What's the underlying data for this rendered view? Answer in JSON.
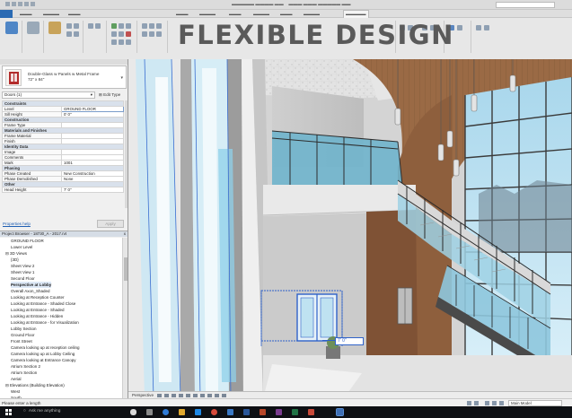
{
  "overlay_title": "FLEXIBLE DESIGN",
  "properties": {
    "type_name_line1": "Double-Glass w Panels w Metal Frame",
    "type_name_line2": "72\" x 84\"",
    "filter_value": "Doors (1)",
    "edit_type_label": "Edit Type",
    "rows": [
      {
        "kind": "section",
        "label": "Constraints"
      },
      {
        "kind": "row",
        "key": "Level",
        "value": "GROUND FLOOR",
        "editing": true
      },
      {
        "kind": "row",
        "key": "Sill Height",
        "value": "0' 0\""
      },
      {
        "kind": "section",
        "label": "Construction"
      },
      {
        "kind": "row",
        "key": "Frame Type",
        "value": ""
      },
      {
        "kind": "section",
        "label": "Materials and Finishes"
      },
      {
        "kind": "row",
        "key": "Frame Material",
        "value": ""
      },
      {
        "kind": "row",
        "key": "Finish",
        "value": ""
      },
      {
        "kind": "section",
        "label": "Identity Data"
      },
      {
        "kind": "row",
        "key": "Image",
        "value": ""
      },
      {
        "kind": "row",
        "key": "Comments",
        "value": ""
      },
      {
        "kind": "row",
        "key": "Mark",
        "value": "1001"
      },
      {
        "kind": "section",
        "label": "Phasing"
      },
      {
        "kind": "row",
        "key": "Phase Created",
        "value": "New Construction"
      },
      {
        "kind": "row",
        "key": "Phase Demolished",
        "value": "None"
      },
      {
        "kind": "section",
        "label": "Other"
      },
      {
        "kind": "row",
        "key": "Head Height",
        "value": "7' 0\""
      }
    ],
    "help_link": "Properties help",
    "apply_label": "Apply"
  },
  "project_browser": {
    "title": "Project Browser - 18730_A - 2017.rvt",
    "close": "x",
    "items": [
      {
        "label": "GROUND FLOOR",
        "indent": 3,
        "selected": false
      },
      {
        "label": "Lower Level",
        "indent": 3,
        "selected": false
      },
      {
        "label": "⊟ 3D Views",
        "indent": 1,
        "selected": false
      },
      {
        "label": "{3D}",
        "indent": 3,
        "selected": false
      },
      {
        "label": "Sheet View 2",
        "indent": 3,
        "selected": false
      },
      {
        "label": "Sheet View 1",
        "indent": 3,
        "selected": false
      },
      {
        "label": "Second Floor",
        "indent": 3,
        "selected": false
      },
      {
        "label": "Perspective at Lobby",
        "indent": 3,
        "selected": true
      },
      {
        "label": "Overall Axon_Shaded",
        "indent": 3,
        "selected": false
      },
      {
        "label": "Looking at Reception Counter",
        "indent": 3,
        "selected": false
      },
      {
        "label": "Looking at Entrance - Shaded Close",
        "indent": 3,
        "selected": false
      },
      {
        "label": "Looking at Entrance - Shaded",
        "indent": 3,
        "selected": false
      },
      {
        "label": "Looking at Entrance - Hidden",
        "indent": 3,
        "selected": false
      },
      {
        "label": "Looking at Entrance - for Visualization",
        "indent": 3,
        "selected": false
      },
      {
        "label": "Lobby Section",
        "indent": 3,
        "selected": false
      },
      {
        "label": "Ground Floor",
        "indent": 3,
        "selected": false
      },
      {
        "label": "Front Street",
        "indent": 3,
        "selected": false
      },
      {
        "label": "Camera looking up at reception ceiling",
        "indent": 3,
        "selected": false
      },
      {
        "label": "Camera looking up at Lobby Ceiling",
        "indent": 3,
        "selected": false
      },
      {
        "label": "Camera looking at Entrance Canopy",
        "indent": 3,
        "selected": false
      },
      {
        "label": "Atrium Section 2",
        "indent": 3,
        "selected": false
      },
      {
        "label": "Atrium Section",
        "indent": 3,
        "selected": false
      },
      {
        "label": "Aerial",
        "indent": 3,
        "selected": false
      },
      {
        "label": "⊟ Elevations (Building Elevation)",
        "indent": 1,
        "selected": false
      },
      {
        "label": "West",
        "indent": 3,
        "selected": false
      },
      {
        "label": "South",
        "indent": 3,
        "selected": false
      }
    ]
  },
  "viewport": {
    "temp_dimension": "7' 0\"",
    "view_label": "Perspective"
  },
  "status": {
    "message": "Please enter a length",
    "model_selector": "Main Model"
  },
  "taskbar": {
    "search_placeholder": "Ask me anything"
  },
  "colors": {
    "ribbon_bg": "#e7e7e7",
    "selection_blue": "#2f62c9",
    "glass": "#8ccbe4",
    "wood": "#9a6a45",
    "taskbar": "#0e1014"
  }
}
